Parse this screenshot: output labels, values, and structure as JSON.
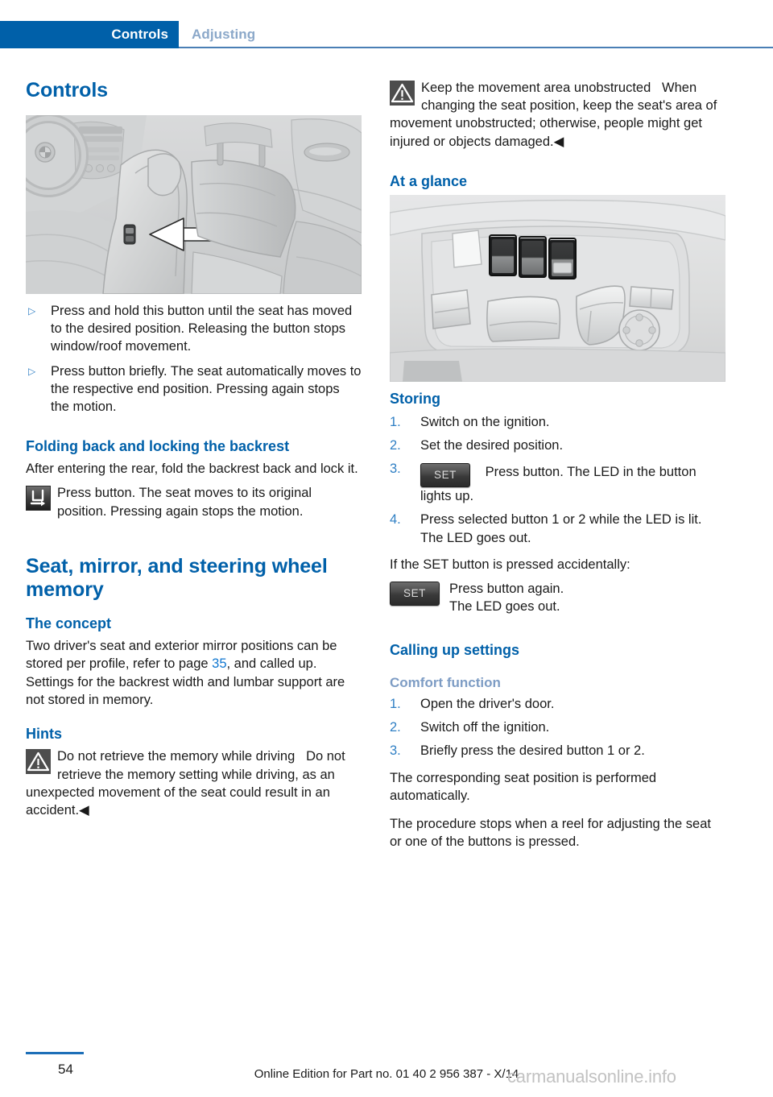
{
  "header": {
    "active_tab": "Controls",
    "inactive_tab": "Adjusting",
    "active_bg": "#0060a9",
    "inactive_color": "#8ba8c9"
  },
  "left_column": {
    "section_title": "Controls",
    "figure_caption": "seat-adjustment-button-illustration",
    "bullets": [
      "Press and hold this button until the seat has moved to the desired position. Releasing the button stops window/roof movement.",
      "Press button briefly. The seat automatically moves to the respective end position. Pressing again stops the motion."
    ],
    "folding": {
      "heading": "Folding back and locking the backrest",
      "intro": "After entering the rear, fold the backrest back and lock it.",
      "icon_note": "Press button. The seat moves to its original position. Pressing again stops the motion."
    },
    "memory": {
      "heading": "Seat, mirror, and steering wheel memory",
      "concept_heading": "The concept",
      "concept_part1": "Two driver's seat and exterior mirror positions can be stored per profile, refer to page ",
      "concept_page_ref": "35",
      "concept_part2": ", and called up. Settings for the backrest width and lumbar support are not stored in memory.",
      "hints_heading": "Hints",
      "warning_title": "Do not retrieve the memory while driving",
      "warning_body": "Do not retrieve the memory setting while driving, as an unexpected movement of the seat could result in an accident.◀"
    }
  },
  "right_column": {
    "warning_title": "Keep the movement area unobstructed",
    "warning_body": "When changing the seat position, keep the seat's area of movement unobstructed; otherwise, people might get injured or objects damaged.◀",
    "at_a_glance_heading": "At a glance",
    "figure_caption": "seat-memory-control-panel-illustration",
    "storing": {
      "heading": "Storing",
      "steps": [
        {
          "num": "1.",
          "text": "Switch on the ignition."
        },
        {
          "num": "2.",
          "text": "Set the desired position."
        },
        {
          "num": "3.",
          "text": "Press button. The LED in the button lights up.",
          "button": "SET"
        },
        {
          "num": "4.",
          "text": "Press selected button 1 or 2 while the LED is lit. The LED goes out."
        }
      ],
      "accidental_note": "If the SET button is pressed accidentally:",
      "set_button_label": "SET",
      "set_line1": "Press button again.",
      "set_line2": "The LED goes out."
    },
    "calling": {
      "heading": "Calling up settings",
      "comfort_heading": "Comfort function",
      "steps": [
        {
          "num": "1.",
          "text": "Open the driver's door."
        },
        {
          "num": "2.",
          "text": "Switch off the ignition."
        },
        {
          "num": "3.",
          "text": "Briefly press the desired button 1 or 2."
        }
      ],
      "para1": "The corresponding seat position is performed automatically.",
      "para2": "The procedure stops when a reel for adjusting the seat or one of the buttons is pressed."
    }
  },
  "footer": {
    "page_number": "54",
    "edition_text": "Online Edition for Part no. 01 40 2 956 387 - X/14",
    "watermark": "carmanualsonline.info"
  }
}
